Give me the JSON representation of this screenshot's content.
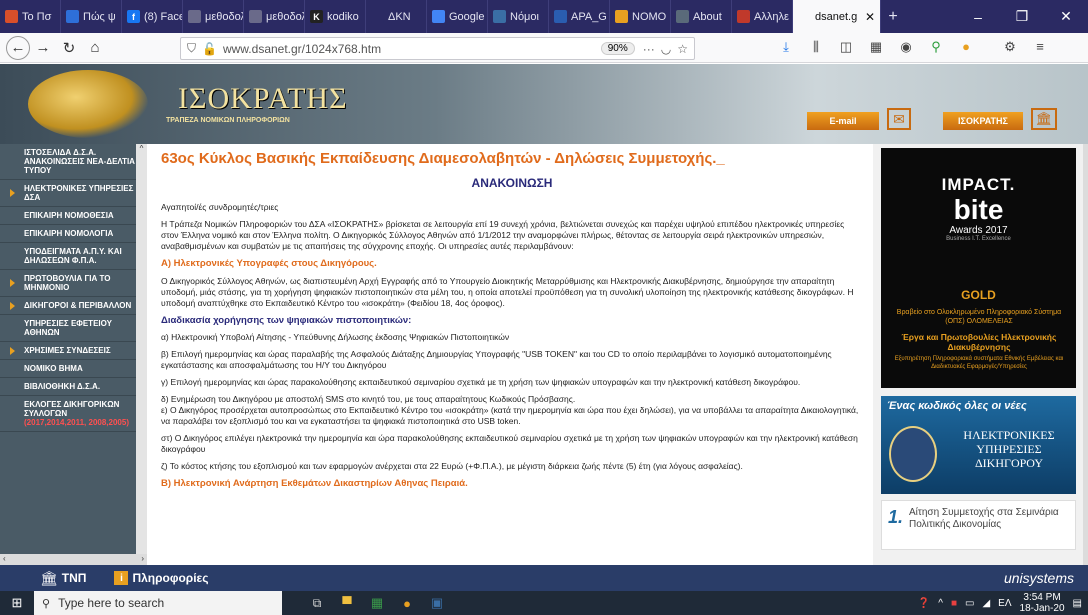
{
  "browser": {
    "tabs": [
      {
        "label": "Το Πσ",
        "fav": "#d94f2a"
      },
      {
        "label": "Πώς ψ",
        "fav": "#2e6fd8"
      },
      {
        "label": "(8) Face",
        "fav": "#1877f2",
        "glyph": "f"
      },
      {
        "label": "μεθοδολογ",
        "fav": "#6a6a8a"
      },
      {
        "label": "μεθοδολογ",
        "fav": "#6a6a8a"
      },
      {
        "label": "kodiko",
        "fav": "#222222",
        "glyph": "K"
      },
      {
        "label": "ΔΚΝ",
        "fav": "#2b2a63"
      },
      {
        "label": "Google",
        "fav": "#4285f4"
      },
      {
        "label": "Νόμοι",
        "fav": "#3a6ea5"
      },
      {
        "label": "APA_G",
        "fav": "#2a5db0"
      },
      {
        "label": "ΝΟΜΟ",
        "fav": "#e8a020"
      },
      {
        "label": "About",
        "fav": "#5a6a7a"
      },
      {
        "label": "Αλληλε",
        "fav": "#c0392b"
      },
      {
        "label": "dsanet.g",
        "fav": "#f9f9fa",
        "active": true
      }
    ],
    "new_tab": "+",
    "url": "www.dsanet.gr/1024x768.htm",
    "zoom": "90%",
    "win_min": "–",
    "win_max": "❐",
    "win_close": "✕"
  },
  "site": {
    "logo_text": "ΙΣΟΚΡΑΤΗΣ",
    "logo_sub": "ΤΡΑΠΕΖΑ ΝΟΜΙΚΩΝ ΠΛΗΡΟΦΟΡΙΩΝ",
    "email_label": "E-mail",
    "isokratis_label": "ΙΣΟΚΡΑΤΗΣ"
  },
  "sidebar": {
    "items": [
      {
        "label": "ΙΣΤΟΣΕΛΙΔΑ Δ.Σ.Α. ΑΝΑΚΟΙΝΩΣΕΙΣ ΝΕΑ-ΔΕΛΤΙΑ ΤΥΠΟΥ",
        "arrow": false
      },
      {
        "label": "ΗΛΕΚΤΡΟΝΙΚΕΣ ΥΠΗΡΕΣΙΕΣ ΔΣΑ",
        "arrow": true
      },
      {
        "label": "ΕΠΙΚΑΙΡΗ ΝΟΜΟΘΕΣΙΑ",
        "arrow": false
      },
      {
        "label": "ΕΠΙΚΑΙΡΗ ΝΟΜΟΛΟΓΙΑ",
        "arrow": false
      },
      {
        "label": "ΥΠΟΔΕΙΓΜΑΤΑ Α.Π.Υ. ΚΑΙ ΔΗΛΩΣΕΩΝ Φ.Π.Α.",
        "arrow": false
      },
      {
        "label": "ΠΡΩΤΟΒΟΥΛΙΑ ΓΙΑ ΤΟ ΜΗΝΜΟΝΙΟ",
        "arrow": true
      },
      {
        "label": "ΔΙΚΗΓΟΡΟΙ & ΠΕΡΙΒΑΛΛΟΝ",
        "arrow": true
      },
      {
        "label": "ΥΠΗΡΕΣΙΕΣ ΕΦΕΤΕΙΟΥ ΑΘΗΝΩΝ",
        "arrow": false
      },
      {
        "label": "ΧΡΗΣΙΜΕΣ ΣΥΝΔΕΣΕΙΣ",
        "arrow": true
      },
      {
        "label": "ΝΟΜΙΚΟ ΒΗΜΑ",
        "arrow": false
      },
      {
        "label": "ΒΙΒΛΙΟΘΗΚΗ Δ.Σ.Α.",
        "arrow": false
      },
      {
        "label": "ΕΚΛΟΓΕΣ ΔΙΚΗΓΟΡΙΚΩΝ ΣΥΛΛΟΓΩΝ",
        "arrow": false,
        "extra": "(2017,2014,2011, 2008,2005)"
      }
    ]
  },
  "content": {
    "title": "63ος Κύκλος Βασικής Εκπαίδευσης Διαμεσολαβητών - Δηλώσεις Συμμετοχής._",
    "announcement": "ΑΝΑΚΟΙΝΩΣΗ",
    "greeting": "Αγαπητοί/ές συνδρομητές/τριες",
    "intro": "Η Τράπεζα Νομικών Πληροφοριών του ΔΣΑ «ΙΣΟΚΡΑΤΗΣ» βρίσκεται σε λειτουργία επί 19 συνεχή χρόνια, βελτιώνεται συνεχώς και παρέχει υψηλού επιπέδου ηλεκτρονικές υπηρεσίες στον Έλληνα νομικό και στον Έλληνα πολίτη. Ο Δικηγορικός Σύλλογος Αθηνών από 1/1/2012 την αναμορφώνει πλήρως, θέτοντας σε λειτουργία σειρά ηλεκτρονικών υπηρεσιών, αναβαθμισμένων και συμβατών με τις απαιτήσεις της σύγχρονης εποχής. Οι υπηρεσίες αυτές περιλαμβάνουν:",
    "section_a": "Α) Ηλεκτρονικές Υπογραφές στους Δικηγόρους.",
    "para_a": "Ο Δικηγορικός Σύλλογος Αθηνών, ως διαπιστευμένη Αρχή Εγγραφής από το Υπουργείο Διοικητικής Μεταρρύθμισης και Ηλεκτρονικής Διακυβέρνησης, δημιούργησε την απαραίτητη υποδομή, μιάς στάσης, για τη χορήγηση ψηφιακών πιστοποιητικών στα μέλη του, η οποία αποτελεί προϋπόθεση για τη συνολική υλοποίηση της ηλεκτρονικής κατάθεσης δικογράφων. Η υποδομή αναπτύχθηκε στο Εκπαιδευτικό Κέντρο του «ισοκράτη» (Φειδίου 18, 4ος όροφος).",
    "procedure_title": "Διαδικασία χορήγησης των ψηφιακών πιστοποιητικών:",
    "steps": [
      "α) Ηλεκτρονική Υποβολή Αίτησης - Υπεύθυνης Δήλωσης έκδοσης Ψηφιακών Πιστοποιητικών",
      "β) Επιλογή ημερομηνίας και ώρας παραλαβής της Ασφαλούς Διάταξης Δημιουργίας Υπογραφής \"USB TOKEN\" και του CD το οποίο περιλαμβάνει το λογισμικό αυτοματοποιημένης εγκατάστασης και αποσφαλμάτωσης του Η/Υ του Δικηγόρου",
      "γ) Επιλογή ημερομηνίας και ώρας παρακολούθησης εκπαιδευτικού σεμιναρίου σχετικά με τη χρήση των ψηφιακών υπογραφών και την ηλεκτρονική κατάθεση δικογράφου.",
      "δ) Ενημέρωση του Δικηγόρου με αποστολή SMS στο κινητό του, με τους απαραίτητους Κωδικούς Πρόσβασης.\nε) Ο Δικηγόρος προσέρχεται αυτοπροσώπως στο Εκπαιδευτικό Κέντρο του «ισοκράτη» (κατά την ημερομηνία και ώρα που έχει δηλώσει), για να υποβάλλει τα απαραίτητα Δικαιολογητικά, να παραλάβει τον εξοπλισμό του και να εγκαταστήσει τα ψηφιακά πιστοποιητικά στο USB token.",
      "στ) Ο Δικηγόρος επιλέγει ηλεκτρονικά την ημερομηνία και ώρα παρακολούθησης εκπαιδευτικού σεμιναρίου σχετικά με τη χρήση των ψηφιακών υπογραφών και την ηλεκτρονική κατάθεση δικογράφου",
      "ζ) Το κόστος κτήσης του εξοπλισμού και των εφαρμογών ανέρχεται στα 22 Ευρώ (+Φ.Π.Α.), με μέγιστη διάρκεια ζωής πέντε (5) έτη (για λόγους ασφαλείας)."
    ],
    "section_b": "Β) Ηλεκτρονική Ανάρτηση Εκθεμάτων Δικαστηρίων Αθηνας Πειραιά."
  },
  "right": {
    "award_top": "IMPACT.",
    "award_mid": "bite",
    "award_year": "Awards 2017",
    "award_sub": "Business I.T. Excellence",
    "gold": "GOLD",
    "award_line1": "Βραβείο στο Ολοκληρωμένο Πληροφοριακό Σύστημα (ΟΠΣ) ΟΛΟΜΕΛΕΙΑΣ",
    "award_line2": "Έργα και Πρωτοβουλίες Ηλεκτρονικής Διακυβέρνησης",
    "award_line3": "Εξυπηρέτηση Πληροφοριακά συστήματα Εθνικής Εμβέλειας και Διαδικτυακές Εφαρμογές/Υπηρεσίες",
    "promo_title": "Ένας κωδικός όλες οι νέες",
    "promo_l1": "ΗΛΕΚΤΡΟΝΙΚΕΣ",
    "promo_l2": "ΥΠΗΡΕΣΙΕΣ",
    "promo_l3": "ΔΙΚΗΓΟΡΟΥ",
    "box1_num": "1.",
    "box1_text": "Αίτηση Συμμετοχής στα Σεμινάρια Πολιτικής Δικονομίας"
  },
  "statusbar": {
    "tnp": "ΤΝΠ",
    "info": "Πληροφορίες",
    "brand": "unisystems"
  },
  "taskbar": {
    "search_placeholder": "Type here to search",
    "lang": "ΕΛ",
    "time": "3:54 PM",
    "date": "18-Jan-20"
  }
}
